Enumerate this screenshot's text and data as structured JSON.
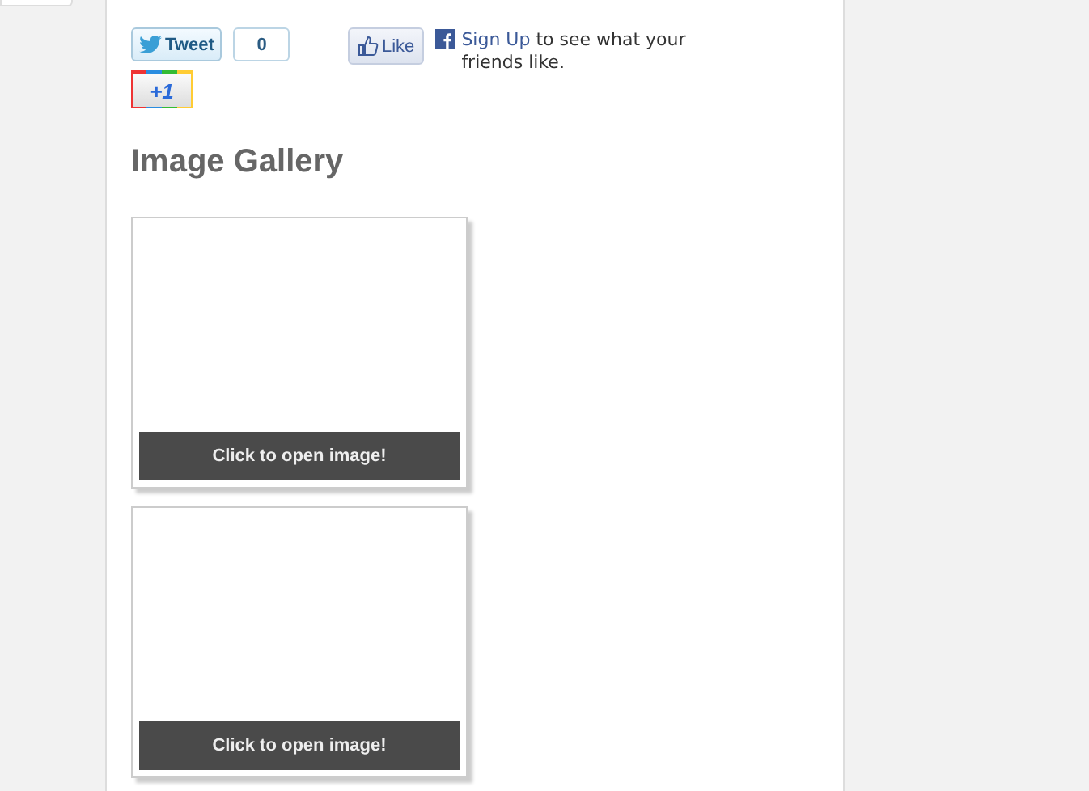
{
  "social": {
    "tweet": {
      "label": "Tweet",
      "count": "0"
    },
    "plus_one": {
      "label": "+1"
    },
    "like": {
      "label": "Like",
      "link": "Sign Up",
      "text": " to see what your friends like."
    }
  },
  "gallery": {
    "title": "Image Gallery",
    "items": [
      {
        "caption": "Click to open image!"
      },
      {
        "caption": "Click to open image!"
      }
    ]
  }
}
